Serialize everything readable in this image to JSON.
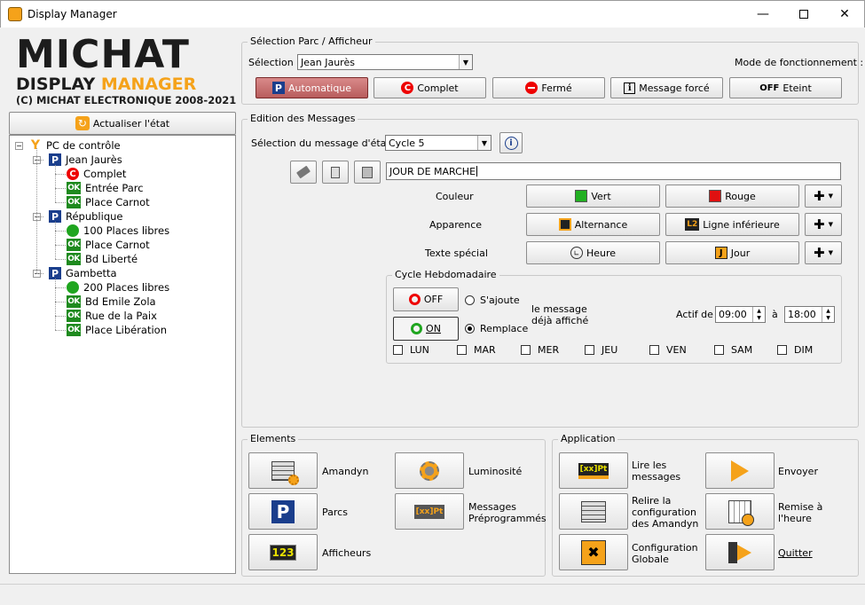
{
  "window": {
    "title": "Display Manager"
  },
  "logo": {
    "line1": "MICHAT",
    "line2_a": "DISPLAY ",
    "line2_b": "MANAGER",
    "line3": "(C) MICHAT ELECTRONIQUE 2008-2021",
    "accent": "#f5a21a",
    "dark": "#1c1c1c"
  },
  "refresh_button": "Actualiser l'état",
  "tree": {
    "root": "PC de contrôle",
    "parks": [
      {
        "name": "Jean Jaurès",
        "items": [
          {
            "icon": "red-c",
            "label": "Complet"
          },
          {
            "icon": "ok",
            "label": "Entrée Parc"
          },
          {
            "icon": "ok",
            "label": "Place Carnot"
          }
        ]
      },
      {
        "name": "République",
        "items": [
          {
            "icon": "green-dot",
            "label": "100 Places libres"
          },
          {
            "icon": "ok",
            "label": "Place Carnot"
          },
          {
            "icon": "ok",
            "label": "Bd Liberté"
          }
        ]
      },
      {
        "name": "Gambetta",
        "items": [
          {
            "icon": "green-dot",
            "label": "200 Places libres"
          },
          {
            "icon": "ok",
            "label": "Bd Emile Zola"
          },
          {
            "icon": "ok",
            "label": "Rue de la Paix"
          },
          {
            "icon": "ok",
            "label": "Place Libération"
          }
        ]
      }
    ]
  },
  "selection": {
    "group_label": "Sélection Parc / Afficheur",
    "sel_label": "Sélection :",
    "sel_value": "Jean Jaurès",
    "mode_label": "Mode de fonctionnement :",
    "modes": [
      "Automatique",
      "Complet",
      "Fermé",
      "Message forcé",
      "Eteint"
    ],
    "active_mode": "Automatique"
  },
  "edition": {
    "group_label": "Edition des Messages",
    "msg_sel_label": "Sélection du message d'état :",
    "msg_sel_value": "Cycle 5",
    "text_value": "JOUR DE MARCHE",
    "couleur_label": "Couleur",
    "couleur": [
      "Vert",
      "Rouge"
    ],
    "couleur_colors": [
      "#22b022",
      "#e01010"
    ],
    "apparence_label": "Apparence",
    "apparence": [
      "Alternance",
      "Ligne inférieure"
    ],
    "l2_badge": "L2",
    "texte_label": "Texte spécial",
    "texte": [
      "Heure",
      "Jour"
    ],
    "j_badge": "J"
  },
  "cycle": {
    "group_label": "Cycle Hebdomadaire",
    "off": "OFF",
    "on": "ON",
    "ajoute": "S'ajoute",
    "remplace": "Remplace",
    "note1": "le message",
    "note2": "déjà affiché",
    "actif_label": "Actif de",
    "from": "09:00",
    "a_label": "à",
    "to": "18:00",
    "days": [
      "LUN",
      "MAR",
      "MER",
      "JEU",
      "VEN",
      "SAM",
      "DIM"
    ]
  },
  "elements": {
    "group_label": "Elements",
    "items": [
      "Amandyn",
      "Luminosité",
      "Parcs",
      "Messages Préprogrammés",
      "Afficheurs"
    ],
    "badge_123": "123"
  },
  "application": {
    "group_label": "Application",
    "items": [
      "Lire les messages",
      "Envoyer",
      "Relire la configuration des Amandyn",
      "Remise à l'heure",
      "Configuration Globale",
      "Quitter"
    ],
    "xx_badge": "[xx]Pt"
  }
}
